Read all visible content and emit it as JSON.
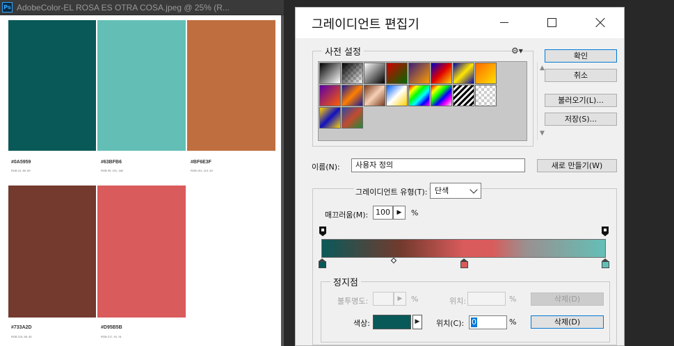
{
  "document": {
    "title": "AdobeColor-EL ROSA ES OTRA COSA.jpeg @ 25% (R...",
    "app_icon": "Ps",
    "swatches": [
      {
        "hex": "#0A5959",
        "rgb": "RGB        10, 89, 89",
        "color": "#0A5959"
      },
      {
        "hex": "#63BFB6",
        "rgb": "RGB        99, 191, 182",
        "color": "#63BFB6"
      },
      {
        "hex": "#BF6E3F",
        "rgb": "RGB        191, 110, 63",
        "color": "#BF6E3F"
      },
      {
        "hex": "#733A2D",
        "rgb": "RGB        115, 58, 45",
        "color": "#733A2D"
      },
      {
        "hex": "#D95B5B",
        "rgb": "RGB        217, 91, 91",
        "color": "#D95B5B"
      }
    ]
  },
  "dialog": {
    "title": "그레이디언트 편집기",
    "presets": {
      "legend": "사전 설정",
      "gear_icon": "gear-icon"
    },
    "buttons": {
      "ok": "확인",
      "cancel": "취소",
      "load": "불러오기(L)...",
      "save": "저장(S)..."
    },
    "name": {
      "label": "이름(N):",
      "value": "사용자 정의",
      "new_button": "새로 만들기(W)"
    },
    "gradient": {
      "type_label": "그레이디언트 유형(T):",
      "type_value": "단색",
      "smoothness_label": "매끄러움(M):",
      "smoothness_value": "100",
      "smoothness_unit": "%",
      "color_stops": [
        {
          "color": "#0A5959",
          "location": 0
        },
        {
          "color": "#D95B5B",
          "location": 50
        },
        {
          "color": "#63BFB6",
          "location": 100
        }
      ],
      "midpoint_location": 25
    },
    "stops": {
      "legend": "정지점",
      "opacity_label": "불투명도:",
      "opacity_unit": "%",
      "opacity_location_label": "위치:",
      "opacity_location_unit": "%",
      "opacity_delete": "삭제(D)",
      "color_label": "색상:",
      "color_value": "#0A5959",
      "location_label": "위치(C):",
      "location_value": "0",
      "location_unit": "%",
      "color_delete": "삭제(D)"
    }
  }
}
